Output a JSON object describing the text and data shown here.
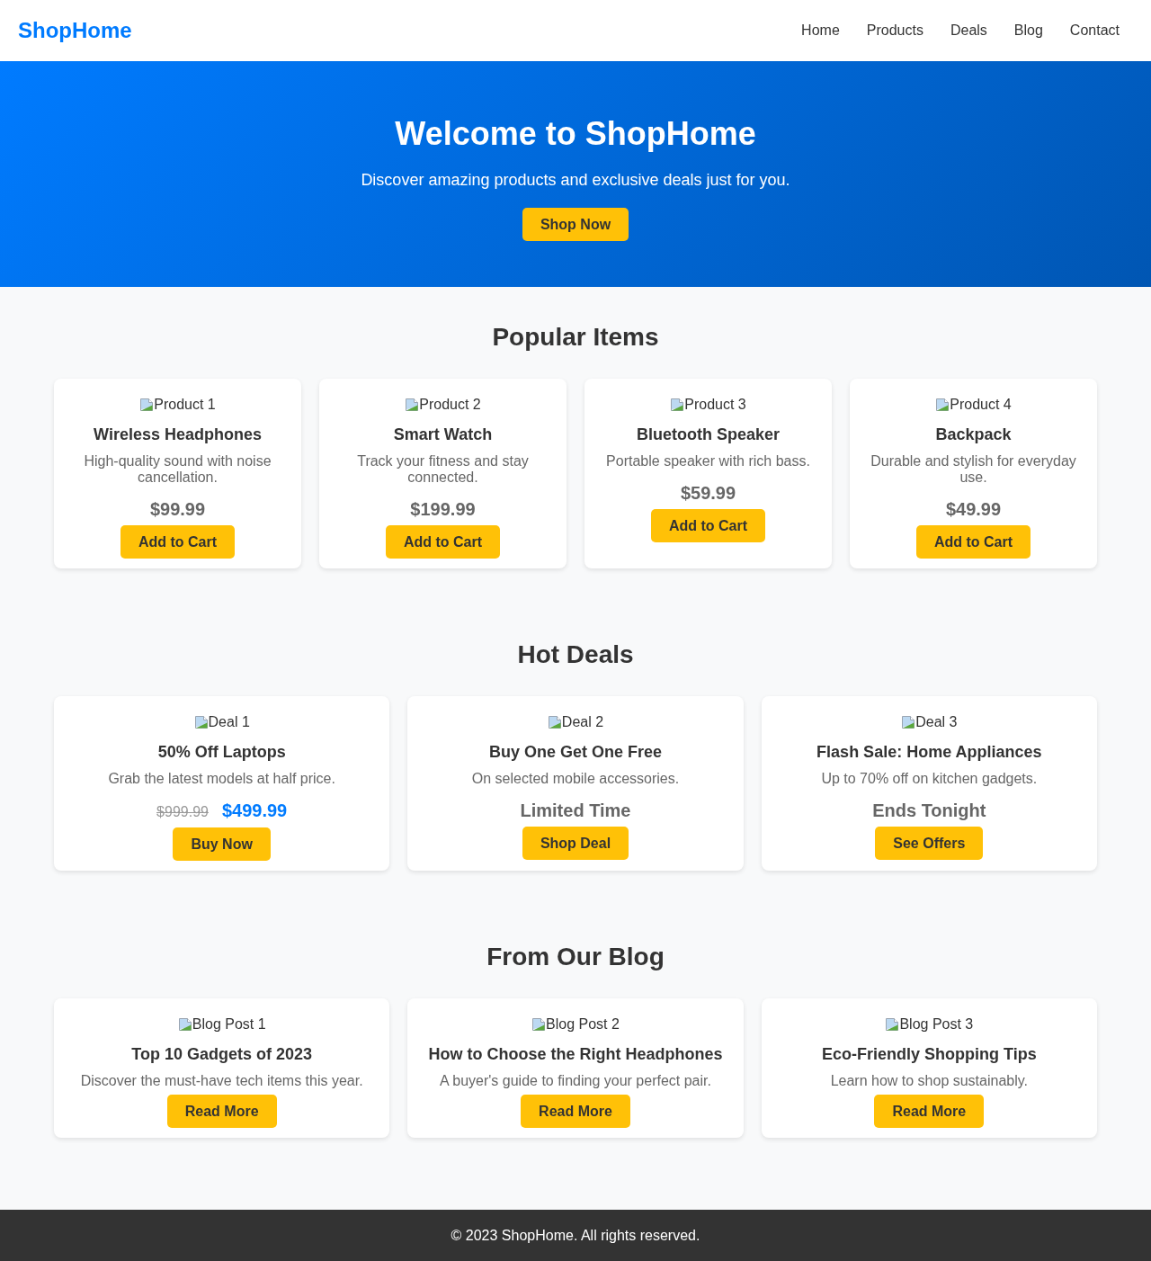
{
  "header": {
    "logo": "ShopHome",
    "nav": [
      "Home",
      "Products",
      "Deals",
      "Blog",
      "Contact"
    ]
  },
  "hero": {
    "title": "Welcome to ShopHome",
    "subtitle": "Discover amazing products and exclusive deals just for you.",
    "button": "Shop Now"
  },
  "popular_items": {
    "heading": "Popular Items",
    "products": [
      {
        "image_alt": "Product 1",
        "name": "Wireless Headphones",
        "description": "High-quality sound with noise cancellation.",
        "price": "$99.99",
        "button": "Add to Cart"
      },
      {
        "image_alt": "Product 2",
        "name": "Smart Watch",
        "description": "Track your fitness and stay connected.",
        "price": "$199.99",
        "button": "Add to Cart"
      },
      {
        "image_alt": "Product 3",
        "name": "Bluetooth Speaker",
        "description": "Portable speaker with rich bass.",
        "price": "$59.99",
        "button": "Add to Cart"
      },
      {
        "image_alt": "Product 4",
        "name": "Backpack",
        "description": "Durable and stylish for everyday use.",
        "price": "$49.99",
        "button": "Add to Cart"
      }
    ]
  },
  "hot_deals": {
    "heading": "Hot Deals",
    "deals": [
      {
        "kind": "price",
        "image_alt": "Deal 1",
        "title": "50% Off Laptops",
        "description": "Grab the latest models at half price.",
        "old_price": "$999.99",
        "new_price": "$499.99",
        "button": "Buy Now"
      },
      {
        "kind": "tag",
        "image_alt": "Deal 2",
        "title": "Buy One Get One Free",
        "description": "On selected mobile accessories.",
        "tag": "Limited Time",
        "button": "Shop Deal"
      },
      {
        "kind": "tag",
        "image_alt": "Deal 3",
        "title": "Flash Sale: Home Appliances",
        "description": "Up to 70% off on kitchen gadgets.",
        "tag": "Ends Tonight",
        "button": "See Offers"
      }
    ]
  },
  "blog": {
    "heading": "From Our Blog",
    "posts": [
      {
        "image_alt": "Blog Post 1",
        "title": "Top 10 Gadgets of 2023",
        "excerpt": "Discover the must-have tech items this year.",
        "button": "Read More"
      },
      {
        "image_alt": "Blog Post 2",
        "title": "How to Choose the Right Headphones",
        "excerpt": "A buyer's guide to finding your perfect pair.",
        "button": "Read More"
      },
      {
        "image_alt": "Blog Post 3",
        "title": "Eco-Friendly Shopping Tips",
        "excerpt": "Learn how to shop sustainably.",
        "button": "Read More"
      }
    ]
  },
  "footer": {
    "text": "© 2023 ShopHome. All rights reserved."
  }
}
